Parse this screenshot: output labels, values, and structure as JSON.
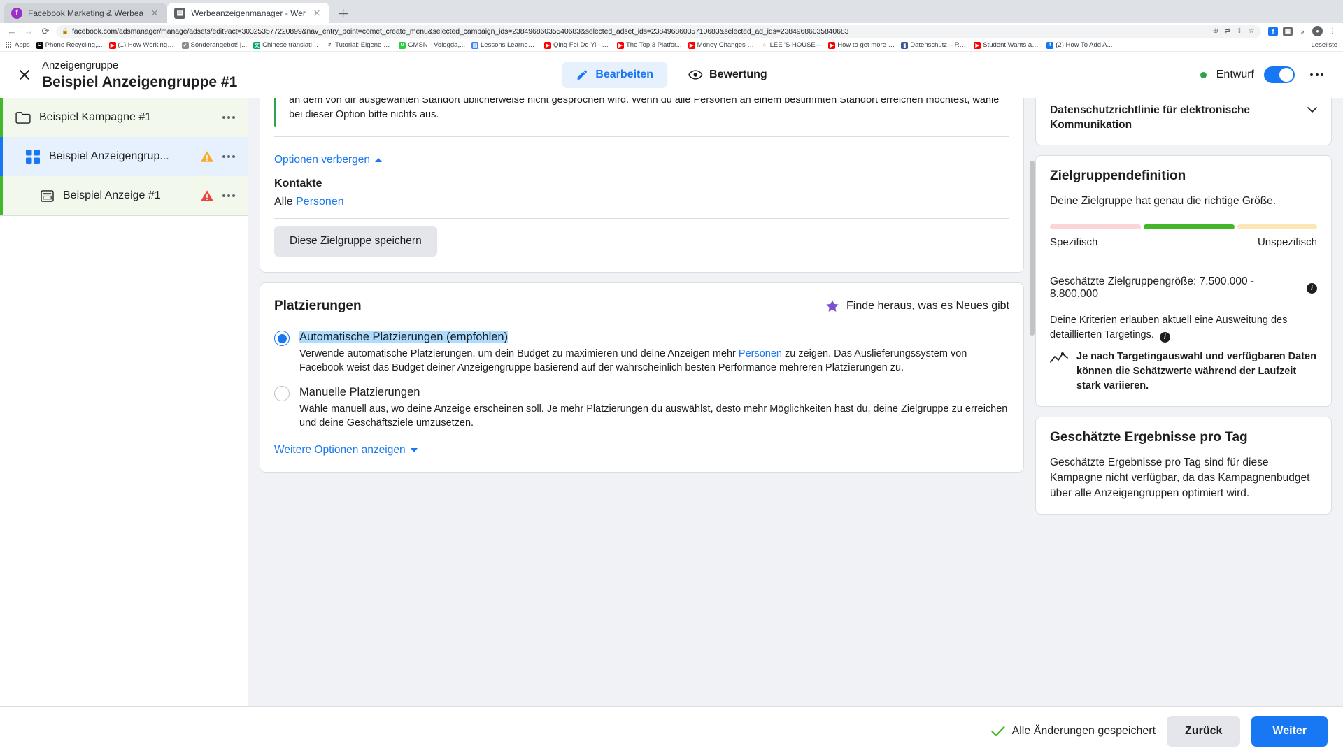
{
  "browser": {
    "tabs": [
      {
        "title": "Facebook Marketing & Werbea",
        "favicon": "facebook-icon",
        "active": false
      },
      {
        "title": "Werbeanzeigenmanager - Wer",
        "favicon": "page-icon",
        "active": true
      }
    ],
    "new_tab_label": "+",
    "nav": {
      "back": "←",
      "forward": "→",
      "reload": "⟳"
    },
    "omnibox": {
      "lock_icon": "lock-icon",
      "url": "facebook.com/adsmanager/manage/adsets/edit?act=303253577220899&nav_entry_point=comet_create_menu&selected_campaign_ids=23849686035540683&selected_adset_ids=23849686035710683&selected_ad_ids=23849686035840683",
      "icons": [
        "zoom-icon",
        "translate-icon",
        "share-icon",
        "star-icon"
      ]
    },
    "extensions": [
      "facebook-ext",
      "grid-ext",
      "chevron-ext",
      "profile-ext",
      "menu-ext"
    ],
    "bookmarks": [
      {
        "label": "Apps",
        "icon": "apps-grid-icon",
        "color": "#5f6368"
      },
      {
        "label": "Phone Recycling,...",
        "icon": "o2-icon",
        "color": "#0a0a0a"
      },
      {
        "label": "(1) How Working a...",
        "icon": "youtube-icon",
        "color": "#ff0000"
      },
      {
        "label": "Sonderangebot! |...",
        "icon": "badge-icon",
        "color": "#6b6b6b"
      },
      {
        "label": "Chinese translatio...",
        "icon": "translate-icon",
        "color": "#00a86b"
      },
      {
        "label": "Tutorial: Eigene Fa...",
        "icon": "hash-icon",
        "color": "#1c1e21"
      },
      {
        "label": "GMSN - Vologda,...",
        "icon": "up-icon",
        "color": "#2ecc40"
      },
      {
        "label": "Lessons Learned f...",
        "icon": "doc-icon",
        "color": "#4285f4"
      },
      {
        "label": "Qing Fei De Yi - Y...",
        "icon": "youtube-icon",
        "color": "#ff0000"
      },
      {
        "label": "The Top 3 Platfor...",
        "icon": "youtube-icon",
        "color": "#ff0000"
      },
      {
        "label": "Money Changes E...",
        "icon": "youtube-icon",
        "color": "#ff0000"
      },
      {
        "label": "LEE 'S HOUSE—",
        "icon": "house-icon",
        "color": "#e8833a"
      },
      {
        "label": "How to get more v...",
        "icon": "youtube-icon",
        "color": "#ff0000"
      },
      {
        "label": "Datenschutz – Re...",
        "icon": "shield-icon",
        "color": "#3b5998"
      },
      {
        "label": "Student Wants an...",
        "icon": "youtube-icon",
        "color": "#ff0000"
      },
      {
        "label": "(2) How To Add A...",
        "icon": "facebook-icon",
        "color": "#1877f2"
      }
    ],
    "reading_list": "Leseliste"
  },
  "header": {
    "close_icon": "close-icon",
    "kicker": "Anzeigengruppe",
    "title": "Beispiel Anzeigengruppe #1",
    "tabs": [
      {
        "label": "Bearbeiten",
        "icon": "pencil-icon",
        "active": true
      },
      {
        "label": "Bewertung",
        "icon": "eye-icon",
        "active": false
      }
    ],
    "status": "Entwurf",
    "status_color": "#31a24c",
    "toggle_on": true,
    "toggle_color": "#1877f2",
    "menu_icon": "kebab-icon"
  },
  "sidebar": {
    "items": [
      {
        "label": "Beispiel Kampagne #1",
        "icon": "folder-icon",
        "type": "campaign",
        "warning": false
      },
      {
        "label": "Beispiel Anzeigengrup...",
        "icon": "adset-grid-icon",
        "type": "adset",
        "warning": true
      },
      {
        "label": "Beispiel Anzeige #1",
        "icon": "ad-card-icon",
        "type": "ad",
        "warning": true
      }
    ],
    "menu_icon": "kebab-icon"
  },
  "main": {
    "geo_note": "an dem von dir ausgewanten Standort ublicherweise nicht gesprochen wird. Wenn du alle Personen an einem bestimmten Standort erreichen möchtest, wähle bei dieser Option bitte nichts aus.",
    "hide_options": "Optionen verbergen",
    "contacts_title": "Kontakte",
    "contacts_value_prefix": "Alle ",
    "contacts_value_link": "Personen",
    "save_audience_button": "Diese Zielgruppe speichern",
    "placements": {
      "title": "Platzierungen",
      "new_badge": "Finde heraus, was es Neues gibt",
      "star_icon": "star-icon",
      "options": [
        {
          "label": "Automatische Platzierungen (empfohlen)",
          "selected": true,
          "highlighted": true,
          "desc_part1": "Verwende automatische Platzierungen, um dein Budget zu maximieren und deine Anzeigen mehr ",
          "desc_link": "Personen",
          "desc_part2": " zu zeigen. Das Auslieferungssystem von Facebook weist das Budget deiner Anzeigengruppe basierend auf der wahrscheinlich besten Performance mehreren Platzierungen zu."
        },
        {
          "label": "Manuelle Platzierungen",
          "selected": false,
          "highlighted": false,
          "desc_part1": "Wähle manuell aus, wo deine Anzeige erscheinen soll. Je mehr Platzierungen du auswählst, desto mehr Möglichkeiten hast du, deine Zielgruppe zu erreichen und deine Geschäftsziele umzusetzen.",
          "desc_link": "",
          "desc_part2": ""
        }
      ],
      "show_more_options": "Weitere Optionen anzeigen"
    }
  },
  "right_panel": {
    "privacy_card": {
      "title": "Datenschutzrichtlinie für elektronische Kommunikation",
      "chevron_icon": "chevron-down-icon"
    },
    "audience_def": {
      "title": "Zielgruppendefinition",
      "subtitle": "Deine Zielgruppe hat genau die richtige Größe.",
      "meter_colors": [
        "#fbd5d7",
        "#42b72a",
        "#fae7b5"
      ],
      "left_label": "Spezifisch",
      "right_label": "Unspezifisch",
      "size_label": "Geschätzte Zielgruppengröße: 7.500.000 - 8.800.000",
      "info_icon": "info-icon",
      "expand_note": "Deine Kriterien erlauben aktuell eine Ausweitung des detaillierten Targetings.",
      "chart_icon": "chart-line-icon",
      "chart_note": "Je nach Targetingauswahl und verfügbaren Daten können die Schätzwerte während der Laufzeit stark variieren."
    },
    "results_card": {
      "title": "Geschätzte Ergebnisse pro Tag",
      "text": "Geschätzte Ergebnisse pro Tag sind für diese Kampagne nicht verfügbar, da das Kampagnenbudget über alle Anzeigengruppen optimiert wird."
    }
  },
  "footer": {
    "saved_text": "Alle Änderungen gespeichert",
    "check_icon": "check-icon",
    "back_button": "Zurück",
    "next_button": "Weiter"
  }
}
